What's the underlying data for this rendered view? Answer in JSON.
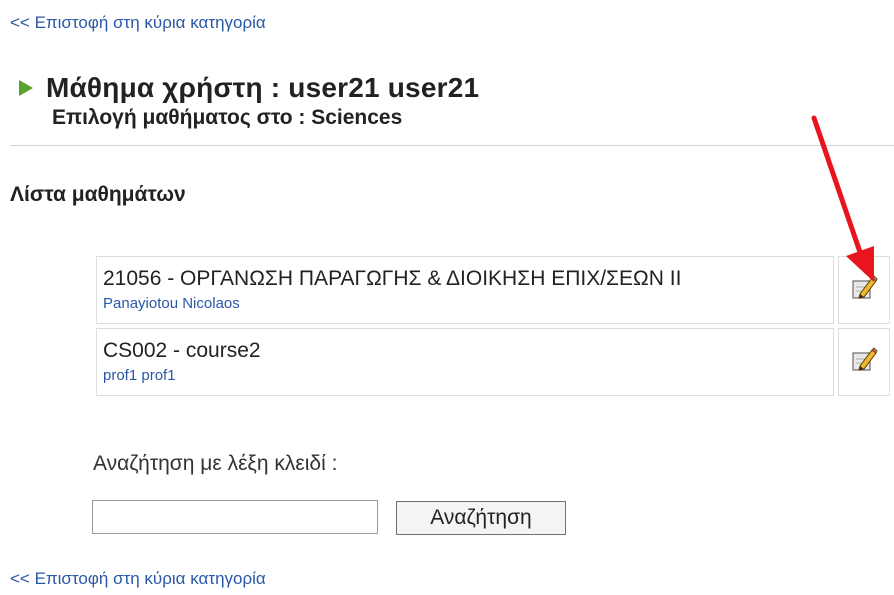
{
  "nav": {
    "back_label": "<< Επιστοφή στη κύρια κατηγορία"
  },
  "header": {
    "title": "Μάθημα χρήστη : user21 user21",
    "subtitle": "Επιλογή μαθήματος στο : Sciences"
  },
  "courses": {
    "heading": "Λίστα μαθημάτων",
    "items": [
      {
        "name": "21056 - ΟΡΓΑΝΩΣΗ ΠΑΡΑΓΩΓΗΣ & ΔΙΟΙΚΗΣΗ ΕΠΙΧ/ΣΕΩΝ ΙΙ",
        "professor": "Panayiotou Nicolaos",
        "action_icon": "pencil-edit-icon"
      },
      {
        "name": "CS002 - course2",
        "professor": "prof1 prof1",
        "action_icon": "pencil-edit-icon"
      }
    ]
  },
  "search": {
    "label": "Αναζήτηση με λέξη κλειδί :",
    "value": "",
    "button_label": "Αναζήτηση"
  },
  "colors": {
    "link": "#2a58a8",
    "title_arrow": "#5aa02c",
    "annotation_arrow": "#e8141e"
  }
}
